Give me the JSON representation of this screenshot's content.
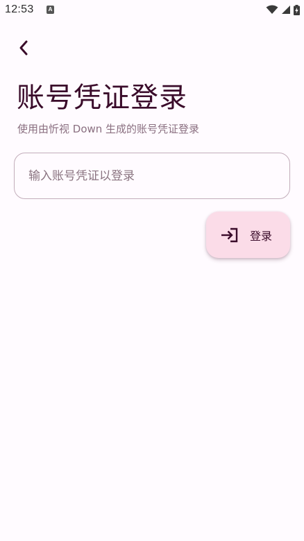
{
  "status_bar": {
    "time": "12:53",
    "notification_icon": "A"
  },
  "page": {
    "title": "账号凭证登录",
    "subtitle": "使用由忻视 Down 生成的账号凭证登录"
  },
  "input": {
    "placeholder": "输入账号凭证以登录",
    "value": ""
  },
  "login_button": {
    "label": "登录"
  },
  "icons": {
    "back": "chevron-left-icon",
    "login": "login-icon",
    "wifi": "wifi-icon",
    "signal": "signal-icon",
    "battery": "battery-charging-icon"
  },
  "colors": {
    "background": "#fffbff",
    "text_primary": "#3a0b2a",
    "text_secondary": "#8a6f80",
    "button_bg": "#fbdce8",
    "input_border": "#c2adba"
  }
}
